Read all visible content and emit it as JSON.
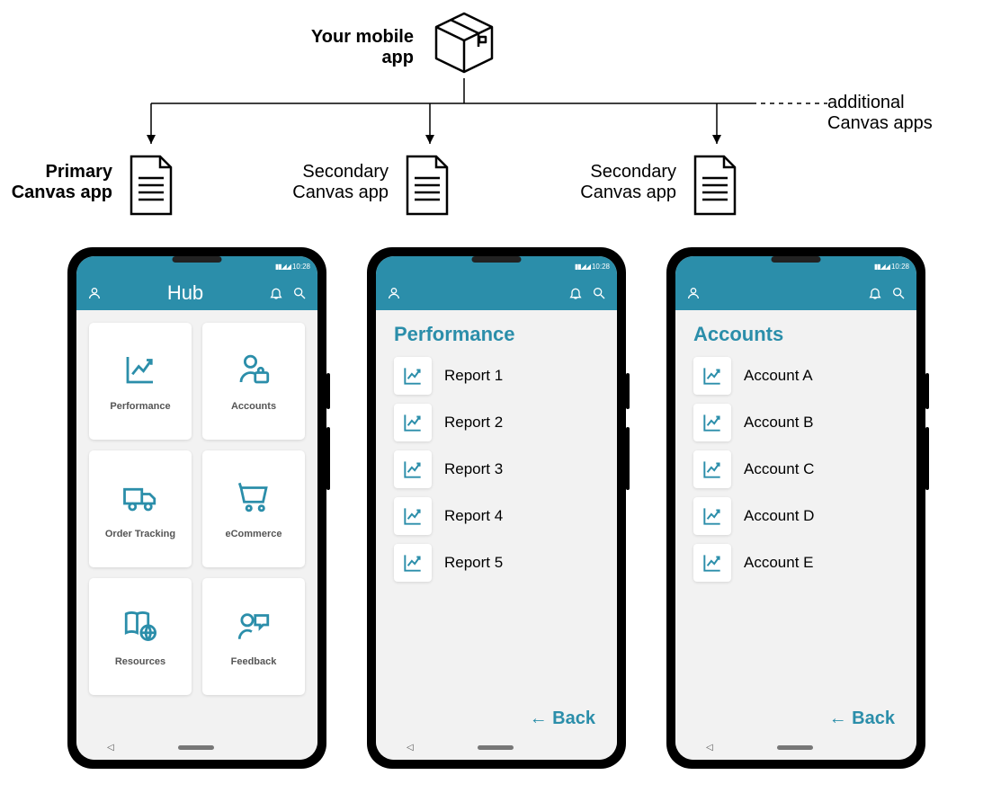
{
  "top": {
    "package_label": "Your mobile app",
    "additional_label1": "additional",
    "additional_label2": "Canvas apps",
    "primary_label1": "Primary",
    "primary_label2": "Canvas app",
    "secondary_label1": "Secondary",
    "secondary_label2": "Canvas app"
  },
  "colors": {
    "brand": "#2b8eaa"
  },
  "status": {
    "time": "10:28"
  },
  "phone1": {
    "title": "Hub",
    "tiles": [
      {
        "label": "Performance",
        "icon": "chart"
      },
      {
        "label": "Accounts",
        "icon": "user-briefcase"
      },
      {
        "label": "Order Tracking",
        "icon": "truck"
      },
      {
        "label": "eCommerce",
        "icon": "cart"
      },
      {
        "label": "Resources",
        "icon": "book-globe"
      },
      {
        "label": "Feedback",
        "icon": "speech"
      }
    ]
  },
  "phone2": {
    "heading": "Performance",
    "items": [
      "Report 1",
      "Report 2",
      "Report 3",
      "Report 4",
      "Report 5"
    ],
    "back": "← Back"
  },
  "phone3": {
    "heading": "Accounts",
    "items": [
      "Account A",
      "Account B",
      "Account C",
      "Account D",
      "Account E"
    ],
    "back": "← Back"
  }
}
